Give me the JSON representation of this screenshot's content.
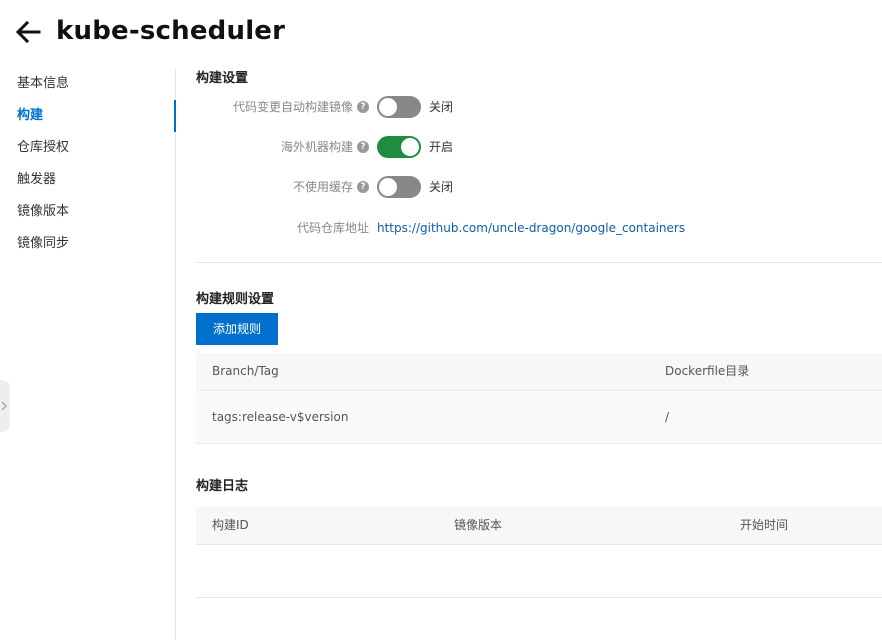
{
  "header": {
    "title": "kube-scheduler"
  },
  "sidebar": {
    "items": [
      {
        "label": "基本信息",
        "active": false
      },
      {
        "label": "构建",
        "active": true
      },
      {
        "label": "仓库授权",
        "active": false
      },
      {
        "label": "触发器",
        "active": false
      },
      {
        "label": "镜像版本",
        "active": false
      },
      {
        "label": "镜像同步",
        "active": false
      }
    ]
  },
  "build_settings": {
    "title": "构建设置",
    "auto_build": {
      "label": "代码变更自动构建镜像",
      "state": "关闭",
      "on": false
    },
    "overseas_build": {
      "label": "海外机器构建",
      "state": "开启",
      "on": true
    },
    "no_cache": {
      "label": "不使用缓存",
      "state": "关闭",
      "on": false
    },
    "repo": {
      "label": "代码仓库地址",
      "url": "https://github.com/uncle-dragon/google_containers"
    },
    "help_glyph": "?"
  },
  "build_rules": {
    "title": "构建规则设置",
    "add_button": "添加规则",
    "columns": [
      "Branch/Tag",
      "Dockerfile目录"
    ],
    "rows": [
      {
        "branch_tag": "tags:release-v$version",
        "dockerfile_dir": "/"
      }
    ]
  },
  "build_logs": {
    "title": "构建日志",
    "columns": [
      "构建ID",
      "镜像版本",
      "开始时间"
    ],
    "rows": []
  },
  "colors": {
    "accent": "#0070cc",
    "toggle_on": "#1e8e3e",
    "toggle_off": "#888888",
    "link": "#0b5fa8"
  },
  "icons": {
    "back": "arrow-left-icon",
    "help": "question-circle-icon",
    "collapse": "chevron-right-icon"
  }
}
